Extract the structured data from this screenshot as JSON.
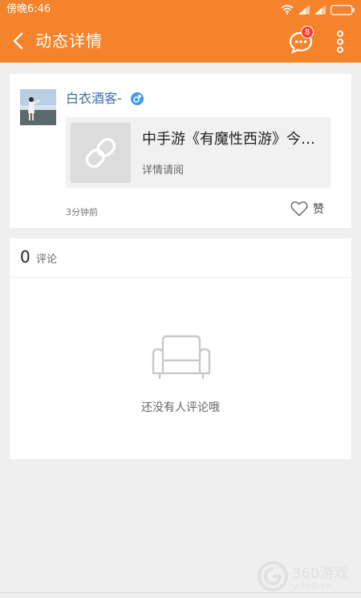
{
  "status_bar": {
    "time": "傍晚6:46",
    "icons": [
      "wifi-icon",
      "signal-icon",
      "signal-icon",
      "battery-icon"
    ]
  },
  "header": {
    "title": "动态详情",
    "message_badge": "8",
    "colors": {
      "bar": "#f5832b",
      "badge": "#ff3b30"
    }
  },
  "post": {
    "username": "白衣酒客-",
    "gender_icon": "male-icon",
    "link": {
      "title": "中手游《有魔性西游》今日首发 明星主播诚意推荐",
      "subtitle": "详情请阅"
    },
    "time_ago": "3分钟前",
    "like_label": "赞"
  },
  "comments": {
    "count": "0",
    "label": "评论",
    "empty_text": "还没有人评论哦"
  },
  "watermark": {
    "text": "360游戏",
    "url": "y.360.cn"
  }
}
